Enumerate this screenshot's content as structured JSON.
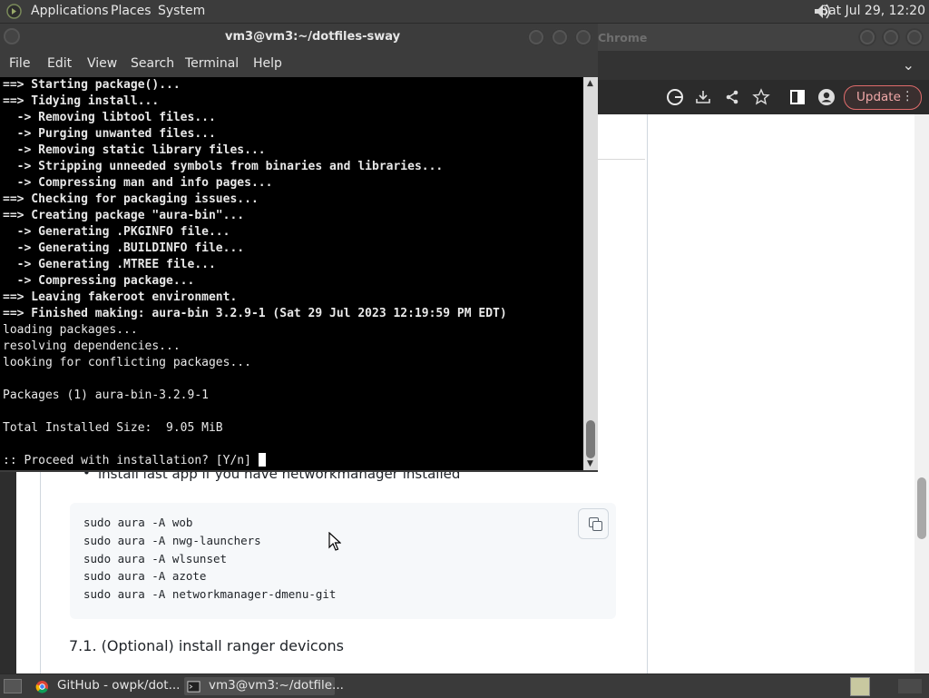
{
  "top_panel": {
    "menus": [
      "Applications",
      "Places",
      "System"
    ],
    "clock": "Sat Jul 29, 12:20"
  },
  "chrome": {
    "title": "Chrome",
    "update_label": "Update",
    "doc": {
      "bullet": "install last app if you have networkmanager installed",
      "code_lines": [
        "sudo aura -A wob",
        "sudo aura -A nwg-launchers",
        "sudo aura -A wlsunset",
        "sudo aura -A azote",
        "sudo aura -A networkmanager-dmenu-git"
      ],
      "heading": "7.1. (Optional) install ranger devicons"
    }
  },
  "terminal": {
    "title": "vm3@vm3:~/dotfiles-sway",
    "menus": [
      "File",
      "Edit",
      "View",
      "Search",
      "Terminal",
      "Help"
    ],
    "lines": [
      {
        "prefix": "==>",
        "text": " Starting package()..."
      },
      {
        "prefix": "==>",
        "text": " Tidying install..."
      },
      {
        "prefix": "  ->",
        "text": " Removing libtool files..."
      },
      {
        "prefix": "  ->",
        "text": " Purging unwanted files..."
      },
      {
        "prefix": "  ->",
        "text": " Removing static library files..."
      },
      {
        "prefix": "  ->",
        "text": " Stripping unneeded symbols from binaries and libraries..."
      },
      {
        "prefix": "  ->",
        "text": " Compressing man and info pages..."
      },
      {
        "prefix": "==>",
        "text": " Checking for packaging issues..."
      },
      {
        "prefix": "==>",
        "text": " Creating package \"aura-bin\"..."
      },
      {
        "prefix": "  ->",
        "text": " Generating .PKGINFO file..."
      },
      {
        "prefix": "  ->",
        "text": " Generating .BUILDINFO file..."
      },
      {
        "prefix": "  ->",
        "text": " Generating .MTREE file..."
      },
      {
        "prefix": "  ->",
        "text": " Compressing package..."
      },
      {
        "prefix": "==>",
        "text": " Leaving fakeroot environment."
      },
      {
        "prefix": "==>",
        "text": " Finished making: aura-bin 3.2.9-1 (Sat 29 Jul 2023 12:19:59 PM EDT)"
      },
      {
        "prefix": "",
        "text": "loading packages..."
      },
      {
        "prefix": "",
        "text": "resolving dependencies..."
      },
      {
        "prefix": "",
        "text": "looking for conflicting packages..."
      },
      {
        "prefix": "",
        "text": ""
      },
      {
        "prefix": "",
        "text": "Packages (1) aura-bin-3.2.9-1"
      },
      {
        "prefix": "",
        "text": ""
      },
      {
        "prefix": "",
        "text": "Total Installed Size:  9.05 MiB"
      },
      {
        "prefix": "",
        "text": ""
      },
      {
        "prefix": "",
        "text": ":: Proceed with installation? [Y/n] "
      }
    ]
  },
  "taskbar": {
    "tasks": [
      {
        "label": "GitHub - owpk/dot...",
        "icon": "chrome-icon"
      },
      {
        "label": "vm3@vm3:~/dotfile...",
        "icon": "terminal-icon"
      }
    ]
  },
  "colors": {
    "panel_bg": "#3c3c3c",
    "terminal_bg": "#000000",
    "update_accent": "#e06c6c"
  }
}
